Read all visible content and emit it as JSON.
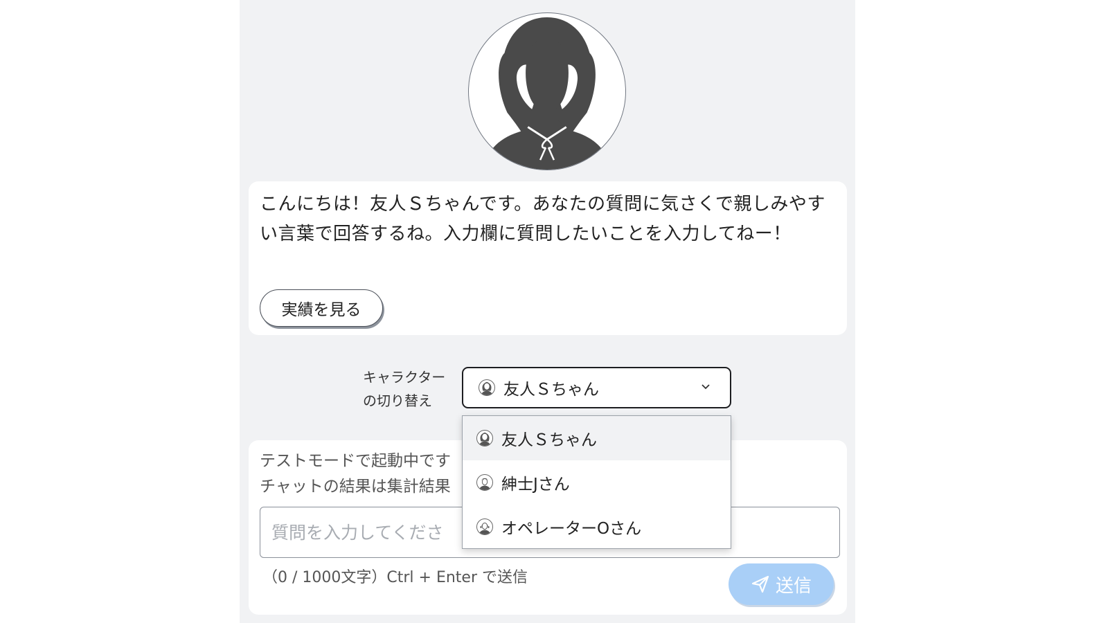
{
  "colors": {
    "panel_background": "#f1f2f4",
    "card_background": "#ffffff",
    "send_button": "#a9cff7",
    "silhouette": "#4a4a4a"
  },
  "character_avatar": {
    "icon": "girl-silhouette-icon"
  },
  "message": {
    "text": "こんにちは！友人Ｓちゃんです。あなたの質問に気さくで親しみやすい言葉で回答するね。入力欄に質問したいことを入力してねー！",
    "achievements_button": "実績を見る"
  },
  "character_switch": {
    "label_line1": "キャラクター",
    "label_line2": "の切り替え",
    "selected": "友人Ｓちゃん",
    "options": [
      {
        "label": "友人Ｓちゃん",
        "icon": "girl-avatar-icon",
        "highlighted": true
      },
      {
        "label": "紳士Jさん",
        "icon": "gentleman-avatar-icon",
        "highlighted": false
      },
      {
        "label": "オペレーターOさん",
        "icon": "operator-avatar-icon",
        "highlighted": false
      }
    ]
  },
  "input_area": {
    "notice_line1": "テストモードで起動中です",
    "notice_line2": "チャットの結果は集計結果",
    "placeholder": "質問を入力してくださ",
    "value": "",
    "counter": "（0 / 1000文字）Ctrl + Enter で送信",
    "send_button": "送信",
    "send_icon": "paper-plane-icon"
  }
}
